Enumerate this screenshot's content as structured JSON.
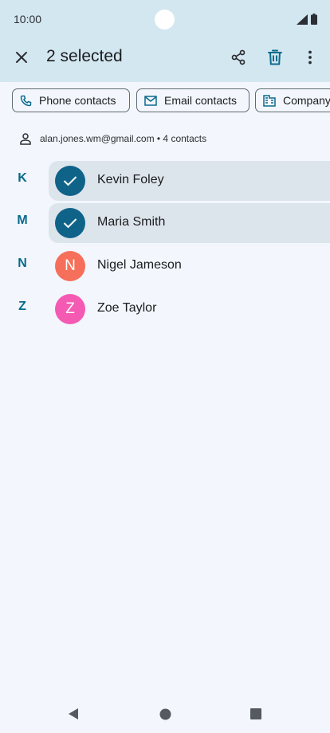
{
  "status": {
    "time": "10:00"
  },
  "toolbar": {
    "title": "2 selected",
    "close_icon": "close-icon",
    "share_icon": "share-icon",
    "delete_icon": "delete-icon",
    "more_icon": "more-vert-icon"
  },
  "chips": [
    {
      "label": "Phone contacts",
      "icon": "phone-icon"
    },
    {
      "label": "Email contacts",
      "icon": "mail-icon"
    },
    {
      "label": "Company",
      "icon": "business-icon"
    }
  ],
  "account": {
    "text": "alan.jones.wm@gmail.com • 4 contacts",
    "icon": "person-icon"
  },
  "contacts": [
    {
      "letter": "K",
      "name": "Kevin Foley",
      "initial": "",
      "selected": true,
      "color": "#0f6389"
    },
    {
      "letter": "M",
      "name": "Maria Smith",
      "initial": "",
      "selected": true,
      "color": "#0f6389"
    },
    {
      "letter": "N",
      "name": "Nigel Jameson",
      "initial": "N",
      "selected": false,
      "color": "#f56f5a"
    },
    {
      "letter": "Z",
      "name": "Zoe Taylor",
      "initial": "Z",
      "selected": false,
      "color": "#f55ab3"
    }
  ],
  "colors": {
    "header": "#d3e7f0",
    "accent": "#0b6a8b",
    "selected_row": "#dde5ec",
    "background": "#f3f7fd"
  },
  "navbar": {
    "back_icon": "back-icon",
    "home_icon": "home-icon",
    "recents_icon": "recents-icon"
  }
}
